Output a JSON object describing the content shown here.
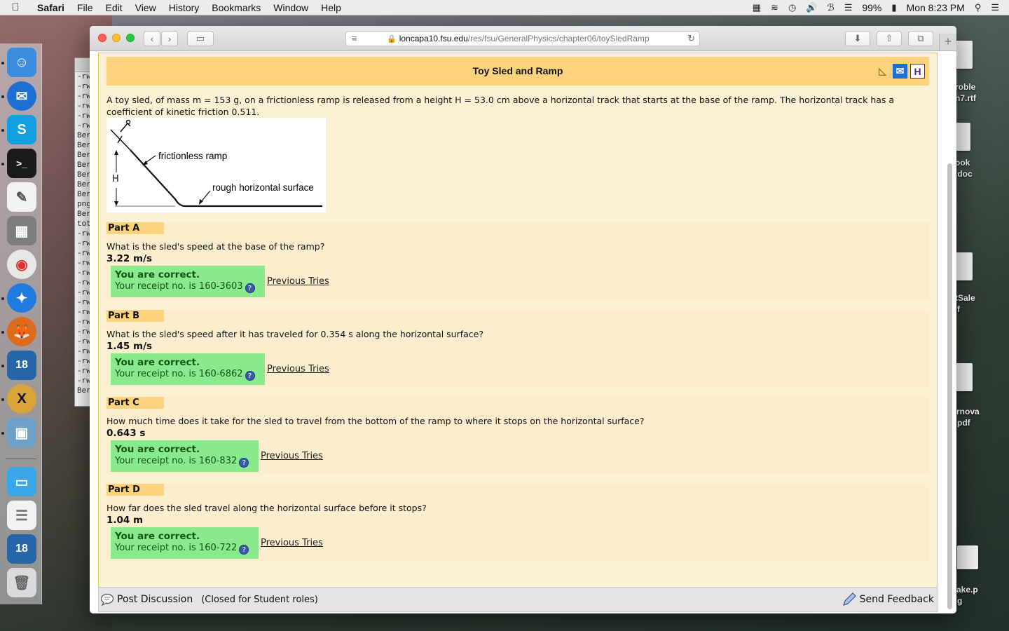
{
  "menubar": {
    "app": "Safari",
    "items": [
      "File",
      "Edit",
      "View",
      "History",
      "Bookmarks",
      "Window",
      "Help"
    ],
    "battery": "99%",
    "clock": "Mon 8:23 PM"
  },
  "browser": {
    "url_domain": "loncapa10.fsu.edu",
    "url_path": "/res/fsu/GeneralPhysics/chapter06/toySledRamp"
  },
  "problem": {
    "title": "Toy Sled and Ramp",
    "intro": "A toy sled, of mass m = 153 g, on a frictionless ramp is released from a height H = 53.0 cm above a horizontal track that starts at the base of the ramp. The horizontal track has a coefficient of kinetic friction 0.511.",
    "diagram": {
      "label_ramp": "frictionless ramp",
      "label_surface": "rough horizontal surface",
      "label_h": "H"
    },
    "correct_text": "You are correct.",
    "previous_tries": "Previous Tries",
    "parts": [
      {
        "label": "Part A",
        "question": "What is the sled's speed at the base of the ramp?",
        "answer": "3.22 m/s",
        "receipt": "Your receipt no. is 160-3603"
      },
      {
        "label": "Part B",
        "question": "What is the sled's speed after it has traveled for 0.354 s along the horizontal surface?",
        "answer": "1.45 m/s",
        "receipt": "Your receipt no. is 160-6862"
      },
      {
        "label": "Part C",
        "question": "How much time does it take for the sled to travel from the bottom of the ramp to where it stops on the horizontal surface?",
        "answer": "0.643 s",
        "receipt": "Your receipt no. is 160-832"
      },
      {
        "label": "Part D",
        "question": "How far does the sled travel along the horizontal surface before it stops?",
        "answer": "1.04 m",
        "receipt": "Your receipt no. is 160-722"
      }
    ]
  },
  "footer": {
    "post_discussion": "Post Discussion",
    "closed_note": "(Closed for Student roles)",
    "send_feedback": "Send Feedback"
  },
  "desktop": {
    "icons": [
      "roble",
      "n7.rtf",
      "ook",
      ".doc",
      "tSale",
      "f",
      "rnova",
      "pdf",
      "ake.p",
      "g"
    ]
  },
  "terminal_lines": [
    "-rw",
    "-rw",
    "-rw",
    "-rw",
    "-rw",
    "-rw",
    "Ber",
    "Ber",
    "Ber",
    "Ber",
    "Ber",
    "Ber",
    "Ber",
    "png",
    "Ber",
    "tot",
    "-rw",
    "-rw",
    "-rw",
    "-rw",
    "-rw",
    "-rw",
    "-rw",
    "-rw",
    "-rw",
    "-rw",
    "-rw",
    "-rw",
    "-rw",
    "-rw",
    "-rw",
    "-rw",
    "Ber"
  ],
  "colors": {
    "title_bg": "#fcd27c",
    "problem_bg": "#fcf1d3",
    "correct_bg": "#88ea8c"
  }
}
